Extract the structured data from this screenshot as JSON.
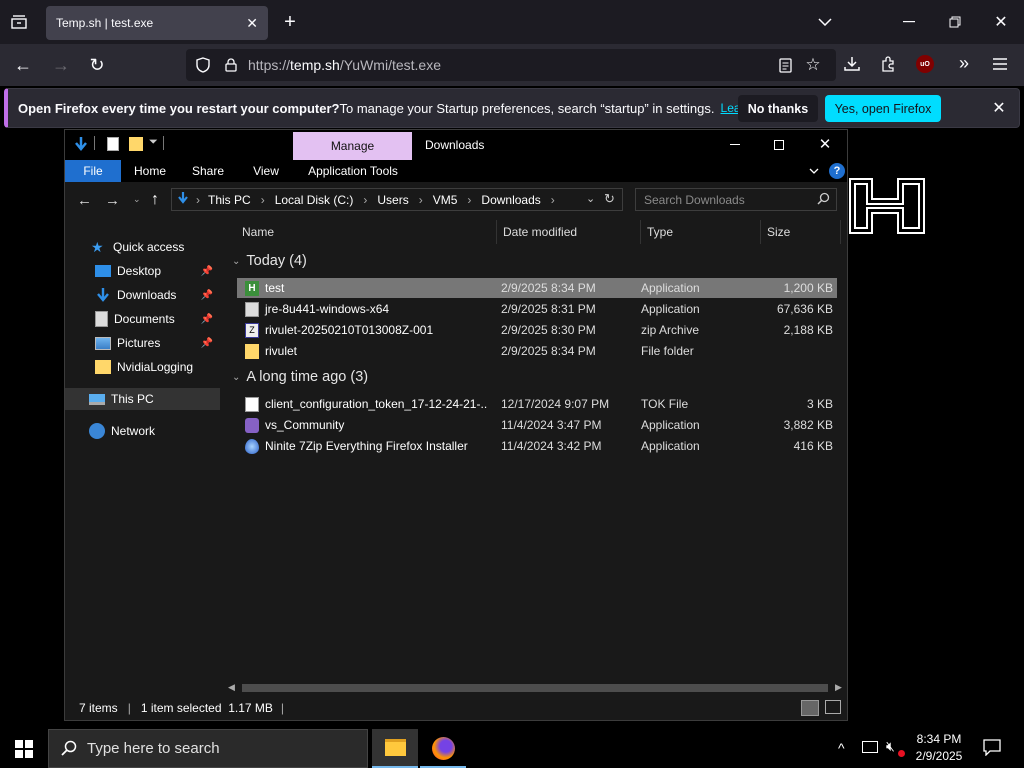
{
  "browser": {
    "tab_title": "Temp.sh | test.exe",
    "url_prefix": "https://",
    "url_host": "temp.sh",
    "url_path": "/YuWmi/test.exe"
  },
  "notification": {
    "bold": "Open Firefox every time you restart your computer?",
    "text": " To manage your Startup preferences, search “startup” in settings.",
    "learn_more": "Learn more",
    "no_thanks": "No thanks",
    "yes_open": "Yes, open Firefox"
  },
  "explorer": {
    "manage_tab": "Manage",
    "window_title": "Downloads",
    "ribbon": [
      "File",
      "Home",
      "Share",
      "View",
      "Application Tools"
    ],
    "breadcrumb": [
      "This PC",
      "Local Disk (C:)",
      "Users",
      "VM5",
      "Downloads"
    ],
    "search_placeholder": "Search Downloads",
    "nav": {
      "quick_access": "Quick access",
      "desktop": "Desktop",
      "downloads": "Downloads",
      "documents": "Documents",
      "pictures": "Pictures",
      "nvidia": "NvidiaLogging",
      "this_pc": "This PC",
      "network": "Network"
    },
    "columns": {
      "name": "Name",
      "date": "Date modified",
      "type": "Type",
      "size": "Size"
    },
    "groups": {
      "today": "Today (4)",
      "long_ago": "A long time ago (3)"
    },
    "files_today": [
      {
        "name": "test",
        "date": "2/9/2025 8:34 PM",
        "type": "Application",
        "size": "1,200 KB"
      },
      {
        "name": "jre-8u441-windows-x64",
        "date": "2/9/2025 8:31 PM",
        "type": "Application",
        "size": "67,636 KB"
      },
      {
        "name": "rivulet-20250210T013008Z-001",
        "date": "2/9/2025 8:30 PM",
        "type": "zip Archive",
        "size": "2,188 KB"
      },
      {
        "name": "rivulet",
        "date": "2/9/2025 8:34 PM",
        "type": "File folder",
        "size": ""
      }
    ],
    "files_old": [
      {
        "name": "client_configuration_token_17-12-24-21-...",
        "date": "12/17/2024 9:07 PM",
        "type": "TOK File",
        "size": "3 KB"
      },
      {
        "name": "vs_Community",
        "date": "11/4/2024 3:47 PM",
        "type": "Application",
        "size": "3,882 KB"
      },
      {
        "name": "Ninite 7Zip Everything Firefox Installer",
        "date": "11/4/2024 3:42 PM",
        "type": "Application",
        "size": "416 KB"
      }
    ],
    "status": {
      "items": "7 items",
      "selected": "1 item selected  1.17 MB"
    }
  },
  "taskbar": {
    "search_placeholder": "Type here to search",
    "time": "8:34 PM",
    "date": "2/9/2025"
  }
}
